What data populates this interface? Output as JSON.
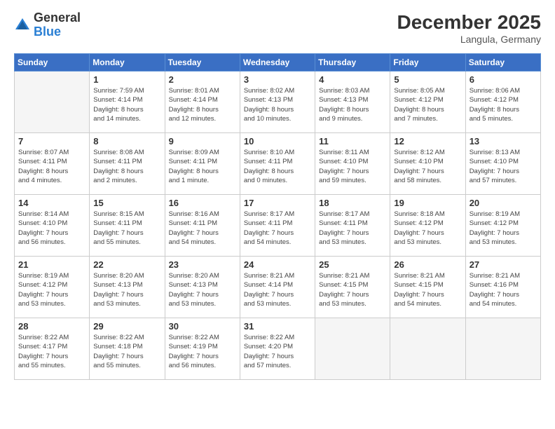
{
  "logo": {
    "general": "General",
    "blue": "Blue"
  },
  "title": "December 2025",
  "location": "Langula, Germany",
  "days_header": [
    "Sunday",
    "Monday",
    "Tuesday",
    "Wednesday",
    "Thursday",
    "Friday",
    "Saturday"
  ],
  "weeks": [
    [
      {
        "day": "",
        "info": ""
      },
      {
        "day": "1",
        "info": "Sunrise: 7:59 AM\nSunset: 4:14 PM\nDaylight: 8 hours\nand 14 minutes."
      },
      {
        "day": "2",
        "info": "Sunrise: 8:01 AM\nSunset: 4:14 PM\nDaylight: 8 hours\nand 12 minutes."
      },
      {
        "day": "3",
        "info": "Sunrise: 8:02 AM\nSunset: 4:13 PM\nDaylight: 8 hours\nand 10 minutes."
      },
      {
        "day": "4",
        "info": "Sunrise: 8:03 AM\nSunset: 4:13 PM\nDaylight: 8 hours\nand 9 minutes."
      },
      {
        "day": "5",
        "info": "Sunrise: 8:05 AM\nSunset: 4:12 PM\nDaylight: 8 hours\nand 7 minutes."
      },
      {
        "day": "6",
        "info": "Sunrise: 8:06 AM\nSunset: 4:12 PM\nDaylight: 8 hours\nand 5 minutes."
      }
    ],
    [
      {
        "day": "7",
        "info": "Sunrise: 8:07 AM\nSunset: 4:11 PM\nDaylight: 8 hours\nand 4 minutes."
      },
      {
        "day": "8",
        "info": "Sunrise: 8:08 AM\nSunset: 4:11 PM\nDaylight: 8 hours\nand 2 minutes."
      },
      {
        "day": "9",
        "info": "Sunrise: 8:09 AM\nSunset: 4:11 PM\nDaylight: 8 hours\nand 1 minute."
      },
      {
        "day": "10",
        "info": "Sunrise: 8:10 AM\nSunset: 4:11 PM\nDaylight: 8 hours\nand 0 minutes."
      },
      {
        "day": "11",
        "info": "Sunrise: 8:11 AM\nSunset: 4:10 PM\nDaylight: 7 hours\nand 59 minutes."
      },
      {
        "day": "12",
        "info": "Sunrise: 8:12 AM\nSunset: 4:10 PM\nDaylight: 7 hours\nand 58 minutes."
      },
      {
        "day": "13",
        "info": "Sunrise: 8:13 AM\nSunset: 4:10 PM\nDaylight: 7 hours\nand 57 minutes."
      }
    ],
    [
      {
        "day": "14",
        "info": "Sunrise: 8:14 AM\nSunset: 4:10 PM\nDaylight: 7 hours\nand 56 minutes."
      },
      {
        "day": "15",
        "info": "Sunrise: 8:15 AM\nSunset: 4:11 PM\nDaylight: 7 hours\nand 55 minutes."
      },
      {
        "day": "16",
        "info": "Sunrise: 8:16 AM\nSunset: 4:11 PM\nDaylight: 7 hours\nand 54 minutes."
      },
      {
        "day": "17",
        "info": "Sunrise: 8:17 AM\nSunset: 4:11 PM\nDaylight: 7 hours\nand 54 minutes."
      },
      {
        "day": "18",
        "info": "Sunrise: 8:17 AM\nSunset: 4:11 PM\nDaylight: 7 hours\nand 53 minutes."
      },
      {
        "day": "19",
        "info": "Sunrise: 8:18 AM\nSunset: 4:12 PM\nDaylight: 7 hours\nand 53 minutes."
      },
      {
        "day": "20",
        "info": "Sunrise: 8:19 AM\nSunset: 4:12 PM\nDaylight: 7 hours\nand 53 minutes."
      }
    ],
    [
      {
        "day": "21",
        "info": "Sunrise: 8:19 AM\nSunset: 4:12 PM\nDaylight: 7 hours\nand 53 minutes."
      },
      {
        "day": "22",
        "info": "Sunrise: 8:20 AM\nSunset: 4:13 PM\nDaylight: 7 hours\nand 53 minutes."
      },
      {
        "day": "23",
        "info": "Sunrise: 8:20 AM\nSunset: 4:13 PM\nDaylight: 7 hours\nand 53 minutes."
      },
      {
        "day": "24",
        "info": "Sunrise: 8:21 AM\nSunset: 4:14 PM\nDaylight: 7 hours\nand 53 minutes."
      },
      {
        "day": "25",
        "info": "Sunrise: 8:21 AM\nSunset: 4:15 PM\nDaylight: 7 hours\nand 53 minutes."
      },
      {
        "day": "26",
        "info": "Sunrise: 8:21 AM\nSunset: 4:15 PM\nDaylight: 7 hours\nand 54 minutes."
      },
      {
        "day": "27",
        "info": "Sunrise: 8:21 AM\nSunset: 4:16 PM\nDaylight: 7 hours\nand 54 minutes."
      }
    ],
    [
      {
        "day": "28",
        "info": "Sunrise: 8:22 AM\nSunset: 4:17 PM\nDaylight: 7 hours\nand 55 minutes."
      },
      {
        "day": "29",
        "info": "Sunrise: 8:22 AM\nSunset: 4:18 PM\nDaylight: 7 hours\nand 55 minutes."
      },
      {
        "day": "30",
        "info": "Sunrise: 8:22 AM\nSunset: 4:19 PM\nDaylight: 7 hours\nand 56 minutes."
      },
      {
        "day": "31",
        "info": "Sunrise: 8:22 AM\nSunset: 4:20 PM\nDaylight: 7 hours\nand 57 minutes."
      },
      {
        "day": "",
        "info": ""
      },
      {
        "day": "",
        "info": ""
      },
      {
        "day": "",
        "info": ""
      }
    ]
  ]
}
